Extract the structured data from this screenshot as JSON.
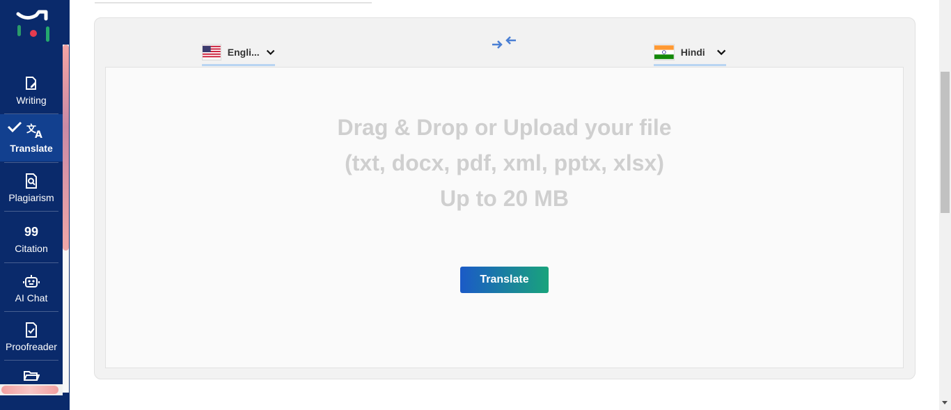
{
  "sidebar": {
    "items": [
      {
        "label": "Writing",
        "icon": "writing-icon"
      },
      {
        "label": "Translate",
        "icon": "translate-icon",
        "active": true
      },
      {
        "label": "Plagiarism",
        "icon": "plagiarism-icon"
      },
      {
        "label": "Citation",
        "icon": "quote-icon"
      },
      {
        "label": "AI Chat",
        "icon": "robot-icon"
      },
      {
        "label": "Proofreader",
        "icon": "proofreader-icon"
      },
      {
        "label": "",
        "icon": "folder-icon"
      }
    ],
    "background": "#0a2a6b",
    "active_background": "#12408f"
  },
  "translator": {
    "source_language": "Engli...",
    "target_language": "Hindi",
    "drop_line1": "Drag & Drop or Upload your file",
    "drop_line2": "(txt, docx, pdf, xml, pptx, xlsx)",
    "drop_line3": "Up to 20 MB",
    "translate_button": "Translate",
    "accent_gradient": [
      "#1b5ac7",
      "#19a37c"
    ]
  }
}
